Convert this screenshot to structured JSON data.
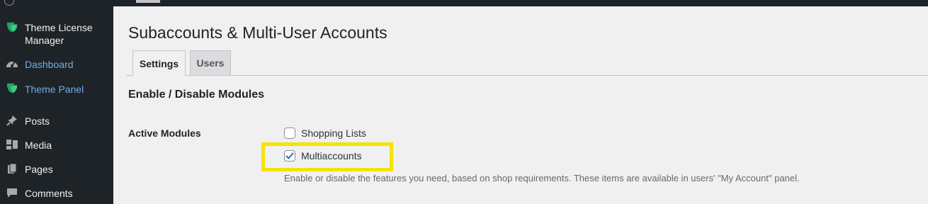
{
  "colors": {
    "sidebar_bg": "#1d2327",
    "sidebar_text": "#f0f0f1",
    "sidebar_active_text": "#72aee6",
    "brand_green": "#21a366",
    "highlight_yellow": "#f5e300",
    "checkbox_blue": "#2271b1",
    "page_bg": "#f0f0f1"
  },
  "sidebar": {
    "items": [
      {
        "label": "Theme License Manager",
        "icon": "leaf-logo-icon"
      },
      {
        "label": "Dashboard",
        "icon": "dashboard-gauge-icon",
        "active": true
      },
      {
        "label": "Theme Panel",
        "icon": "leaf-logo-icon",
        "active": true
      },
      {
        "label": "Posts",
        "icon": "pushpin-icon"
      },
      {
        "label": "Media",
        "icon": "media-icon"
      },
      {
        "label": "Pages",
        "icon": "pages-icon"
      },
      {
        "label": "Comments",
        "icon": "comment-bubble-icon"
      }
    ]
  },
  "main": {
    "title": "Subaccounts & Multi-User Accounts",
    "tabs": [
      {
        "label": "Settings",
        "active": true
      },
      {
        "label": "Users",
        "active": false
      }
    ],
    "section_title": "Enable / Disable Modules",
    "field_label": "Active Modules",
    "modules": [
      {
        "label": "Shopping Lists",
        "checked": false
      },
      {
        "label": "Multiaccounts",
        "checked": true,
        "highlighted": true
      }
    ],
    "description": "Enable or disable the features you need, based on shop requirements. These items are available in users' \"My Account\" panel."
  }
}
